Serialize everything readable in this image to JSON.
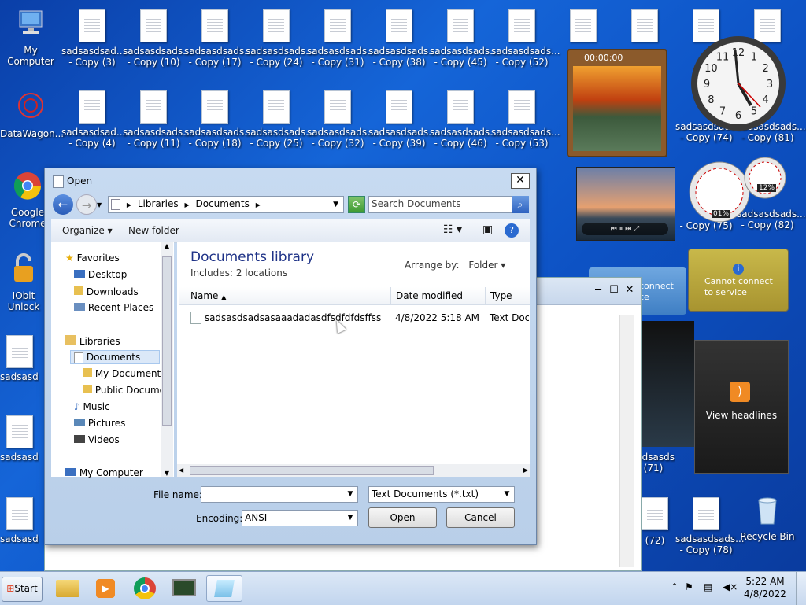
{
  "desktop": {
    "my_computer": "My Computer",
    "datawagon": "DataWagon...",
    "google_chrome": "Google Chrome",
    "iobit": "IObit Unlock",
    "recycle_bin": "Recycle Bin",
    "sadsasds_left": "sadsasds",
    "row1": [
      {
        "name": "sadsasdsad...",
        "copy": "- Copy (3)"
      },
      {
        "name": "sadsasdsads...",
        "copy": "- Copy (10)"
      },
      {
        "name": "sadsasdsads...",
        "copy": "- Copy (17)"
      },
      {
        "name": "sadsasdsads...",
        "copy": "- Copy (24)"
      },
      {
        "name": "sadsasdsads...",
        "copy": "- Copy (31)"
      },
      {
        "name": "sadsasdsads...",
        "copy": "- Copy (38)"
      },
      {
        "name": "sadsasdsads...",
        "copy": "- Copy (45)"
      },
      {
        "name": "sadsasdsads...",
        "copy": "- Copy (52)"
      }
    ],
    "row2": [
      {
        "name": "sadsasdsad...",
        "copy": "- Copy (4)"
      },
      {
        "name": "sadsasdsads...",
        "copy": "- Copy (11)"
      },
      {
        "name": "sadsasdsads...",
        "copy": "- Copy (18)"
      },
      {
        "name": "sadsasdsads...",
        "copy": "- Copy (25)"
      },
      {
        "name": "sadsasdsads...",
        "copy": "- Copy (32)"
      },
      {
        "name": "sadsasdsads...",
        "copy": "- Copy (39)"
      },
      {
        "name": "sadsasdsads...",
        "copy": "- Copy (46)"
      },
      {
        "name": "sadsasdsads...",
        "copy": "- Copy (53)"
      }
    ],
    "right_partial": {
      "r2a": "sadsasdsads...",
      "r2a_copy": "- Copy (74)",
      "r2b": "sadsasdsads...",
      "r2b_copy": "- Copy (81)",
      "r3b": "sadsasdsads...",
      "r3b_copy": "- Copy (82)",
      "r3a_copy": "- Copy (75)",
      "r6_copy": "- Copy (78)",
      "r6_name": "sadsasdsads...",
      "r5": "sadsasdsads...",
      "r5_copy": "(71)",
      "r6b_copy": "(72)"
    }
  },
  "gadgets": {
    "puzzle_timer": "00:00:00",
    "clock_numbers": [
      "12",
      "1",
      "2",
      "3",
      "4",
      "5",
      "6",
      "7",
      "8",
      "9",
      "10",
      "11"
    ],
    "cpu_percent": "01%",
    "mem_percent": "12%",
    "weather_text": "Cannot connect to service",
    "weather_partial": "connect ce",
    "feed_text": "View headlines"
  },
  "dialog": {
    "title": "Open",
    "breadcrumb": [
      "Libraries",
      "Documents"
    ],
    "search_placeholder": "Search Documents",
    "organize": "Organize",
    "new_folder": "New folder",
    "nav": {
      "favorites": "Favorites",
      "desktop": "Desktop",
      "downloads": "Downloads",
      "recent": "Recent Places",
      "libraries": "Libraries",
      "documents": "Documents",
      "my_documents": "My Documents",
      "public_documents": "Public Docume",
      "music": "Music",
      "pictures": "Pictures",
      "videos": "Videos",
      "my_computer": "My Computer"
    },
    "library_title": "Documents library",
    "library_includes": "Includes:",
    "library_locations": "2 locations",
    "arrange_by": "Arrange by:",
    "arrange_value": "Folder",
    "columns": [
      "Name",
      "Date modified",
      "Type"
    ],
    "files": [
      {
        "name": "sadsasdsadsasaaadadasdfsdfdfdsffssfdsf...",
        "date": "4/8/2022 5:18 AM",
        "type": "Text Docu"
      }
    ],
    "file_name_label": "File name:",
    "file_name_value": "",
    "file_type_value": "Text Documents (*.txt)",
    "encoding_label": "Encoding:",
    "encoding_value": "ANSI",
    "open_button": "Open",
    "cancel_button": "Cancel"
  },
  "taskbar": {
    "start": "Start",
    "time": "5:22 AM",
    "date": "4/8/2022"
  }
}
